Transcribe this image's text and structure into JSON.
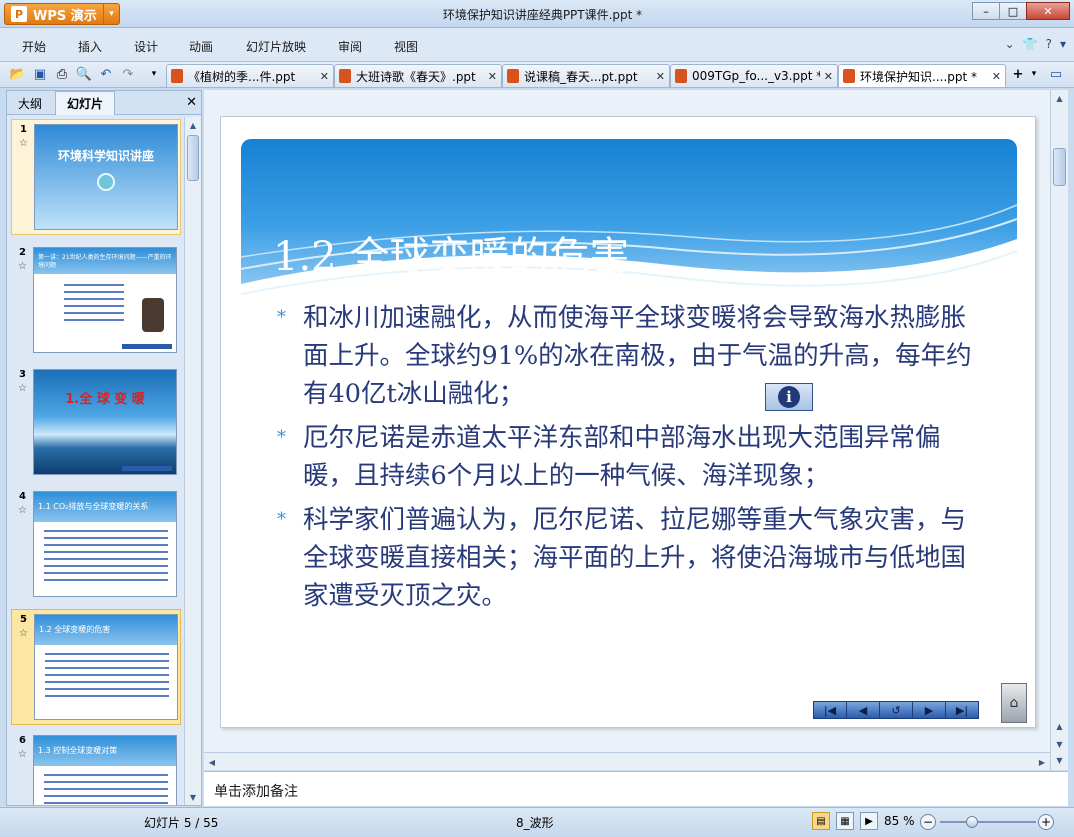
{
  "app": {
    "logo_text": "WPS 演示",
    "window_title": "环境保护知识讲座经典PPT课件.ppt *"
  },
  "menu": {
    "items": [
      "开始",
      "插入",
      "设计",
      "动画",
      "幻灯片放映",
      "审阅",
      "视图"
    ]
  },
  "doc_tabs": [
    {
      "label": "《植树的季...件.ppt",
      "active": false
    },
    {
      "label": "大班诗歌《春天》.ppt",
      "active": false
    },
    {
      "label": "说课稿_春天...pt.ppt",
      "active": false
    },
    {
      "label": "009TGp_fo..._v3.ppt *",
      "active": false
    },
    {
      "label": "环境保护知识....ppt *",
      "active": true
    }
  ],
  "left_panel": {
    "tab_outline": "大纲",
    "tab_slides": "幻灯片",
    "thumbnails": [
      {
        "num": "1",
        "title": "环境科学知识讲座",
        "style": "title"
      },
      {
        "num": "2",
        "title": "第一讲：21世纪人类的生存环境问题——严重的环境问题",
        "style": "list"
      },
      {
        "num": "3",
        "title": "1.全 球 变 暖",
        "style": "iceberg"
      },
      {
        "num": "4",
        "title": "1.1  CO₂排放与全球变暖的关系",
        "style": "text"
      },
      {
        "num": "5",
        "title": "1.2 全球变暖的危害",
        "style": "text",
        "selected": true
      },
      {
        "num": "6",
        "title": "1.3 控制全球变暖对策",
        "style": "text"
      }
    ]
  },
  "slide": {
    "title": "1.2  全球变暖的危害",
    "bullet_marker": "*",
    "bullets": [
      "和冰川加速融化，从而使海平全球变暖将会导致海水热膨胀面上升。全球约91%的冰在南极，由于气温的升高，每年约有40亿t冰山融化；",
      "厄尔尼诺是赤道太平洋东部和中部海水出现大范围异常偏暖，且持续6个月以上的一种气候、海洋现象；",
      "科学家们普遍认为，厄尔尼诺、拉尼娜等重大气象灾害，与全球变暖直接相关；海平面的上升，将使沿海城市与低地国家遭受灭顶之灾。"
    ],
    "info_icon": "i"
  },
  "notes": {
    "placeholder": "单击添加备注"
  },
  "status": {
    "slide_counter": "幻灯片 5 / 55",
    "theme": "8_波形",
    "zoom": "85 %",
    "zoom_level": 0.33
  }
}
